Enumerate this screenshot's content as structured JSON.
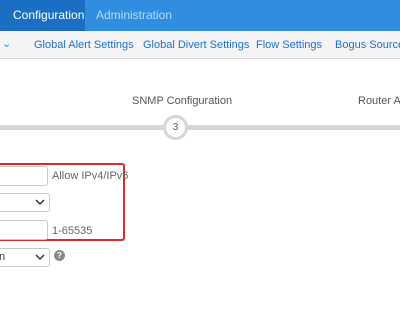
{
  "topbar": {
    "tabs": [
      {
        "label": "Configuration"
      },
      {
        "label": "Administration"
      }
    ]
  },
  "subnav": {
    "items": [
      {
        "label": "Global Alert Settings"
      },
      {
        "label": "Global Divert Settings"
      },
      {
        "label": "Flow Settings"
      },
      {
        "label": "Bogus Source I"
      }
    ]
  },
  "wizard": {
    "step3_label": "SNMP Configuration",
    "step4_label": "Router Ale",
    "step3_number": "3"
  },
  "form": {
    "ip_hint": "Allow IPv4/IPv6",
    "port_hint": "1-65535",
    "bottom_select_value": "n"
  },
  "colors": {
    "primary": "#2f8ee0",
    "active_tab": "#1a6fc4",
    "highlight": "#e12828"
  }
}
